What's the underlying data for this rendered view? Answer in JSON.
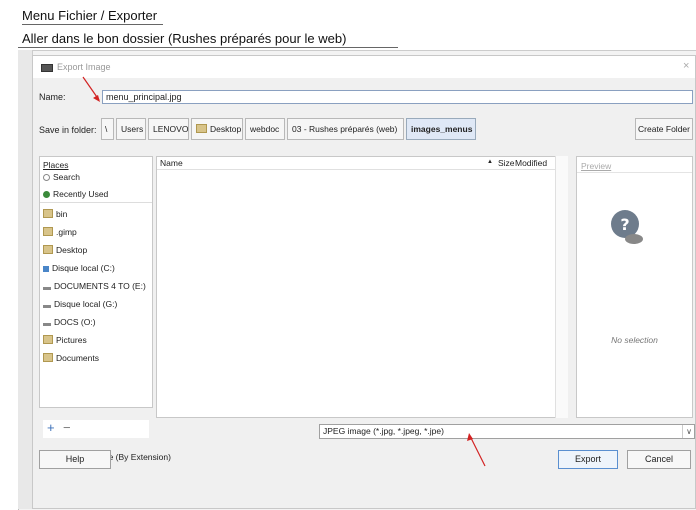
{
  "captions": {
    "step1": "Menu Fichier / Exporter",
    "step2": "Aller dans le bon dossier (Rushes préparés pour le web)"
  },
  "dialog": {
    "title": "Export Image",
    "close_glyph": "×",
    "name_label": "Name:",
    "name_value": "menu_principal.jpg",
    "save_in_label": "Save in folder:",
    "path": [
      "\\",
      "Users",
      "LENOVO",
      "Desktop",
      "webdoc",
      "03 - Rushes préparés (web)",
      "images_menus"
    ],
    "create_folder": "Create Folder",
    "places_header": "Places",
    "places": [
      {
        "label": "Search",
        "icon": "search-icon"
      },
      {
        "label": "Recently Used",
        "icon": "recent-icon"
      },
      {
        "label": "bin",
        "icon": "folder-icon"
      },
      {
        "label": ".gimp",
        "icon": "folder-icon"
      },
      {
        "label": "Desktop",
        "icon": "folder-icon"
      },
      {
        "label": "Disque local (C:)",
        "icon": "drive-icon"
      },
      {
        "label": "DOCUMENTS 4 TO (E:)",
        "icon": "drive-icon"
      },
      {
        "label": "Disque local (G:)",
        "icon": "drive-icon"
      },
      {
        "label": "DOCS (O:)",
        "icon": "drive-icon"
      },
      {
        "label": "Pictures",
        "icon": "folder-icon"
      },
      {
        "label": "Documents",
        "icon": "folder-icon"
      }
    ],
    "columns": {
      "name": "Name",
      "size": "Size",
      "modified": "Modified"
    },
    "sort_glyph": "▲",
    "add_glyph": "+",
    "remove_glyph": "−",
    "preview_header": "Preview",
    "preview_empty": "No selection",
    "file_type_value": "JPEG image (*.jpg, *.jpeg, *.jpe)",
    "dropdown_glyph": "∨",
    "select_file_type": "Select File Type (By Extension)",
    "help": "Help",
    "export": "Export",
    "cancel": "Cancel"
  },
  "colors": {
    "annotation": "#d22222",
    "accent": "#5a8fd0"
  }
}
